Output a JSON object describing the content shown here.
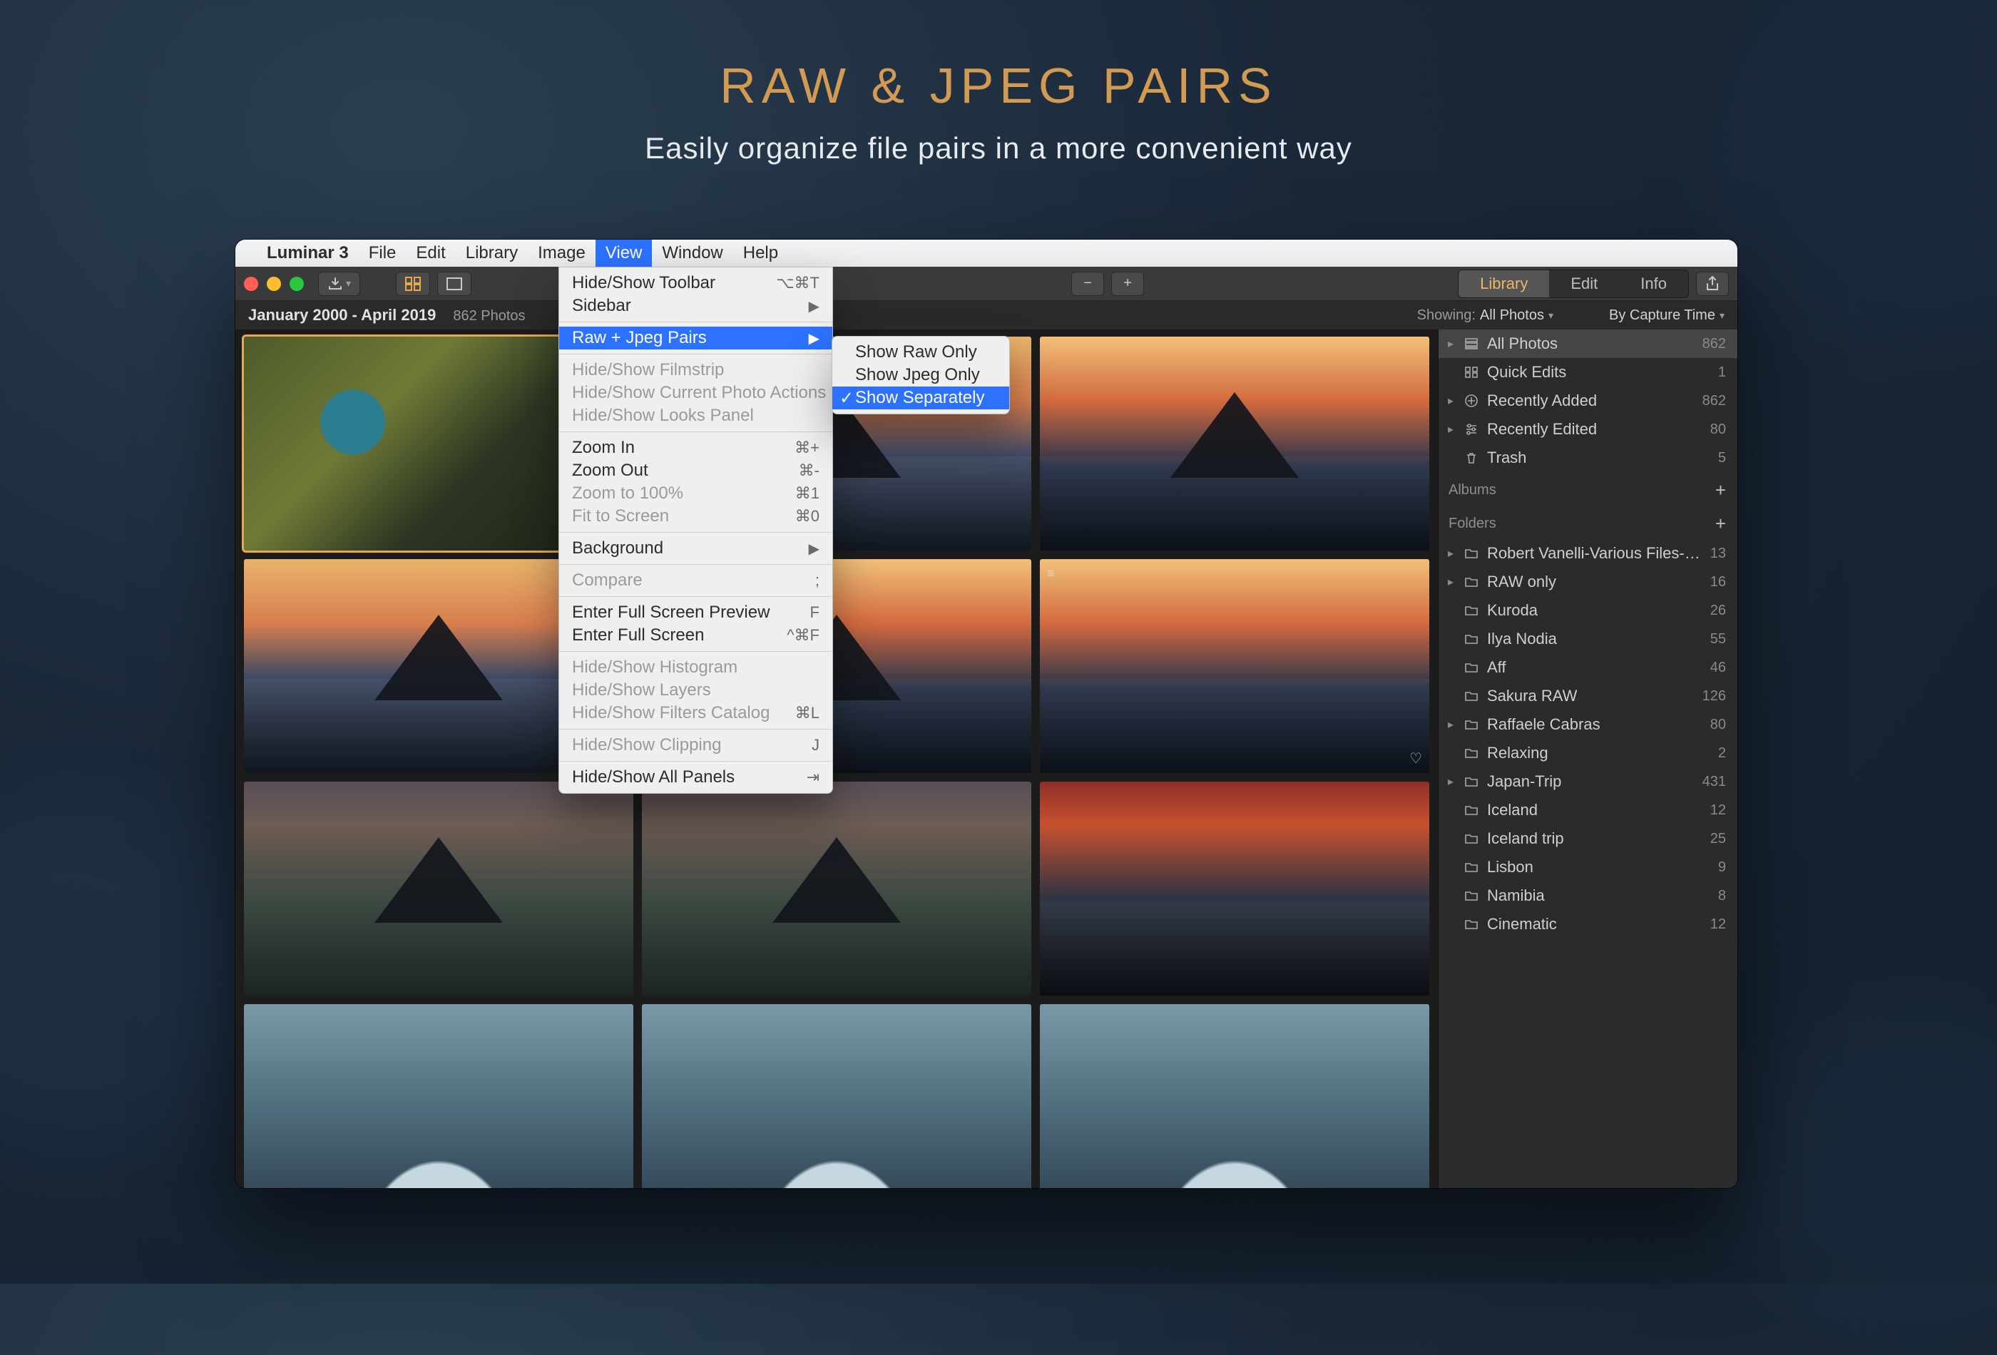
{
  "promo": {
    "headline": "RAW & JPEG PAIRS",
    "subhead": "Easily organize file pairs in a more convenient way"
  },
  "menubar": {
    "app_name": "Luminar 3",
    "items": [
      "File",
      "Edit",
      "Library",
      "Image",
      "View",
      "Window",
      "Help"
    ],
    "active_index": 4
  },
  "toolbar": {
    "segments": {
      "library": "Library",
      "edit": "Edit",
      "info": "Info",
      "active": "library"
    }
  },
  "context": {
    "title": "All Photos",
    "date_range": "January 2000 - April 2019",
    "count_label": "862 Photos",
    "showing_label": "Showing:",
    "showing_value": "All Photos",
    "sort_label": "By Capture Time"
  },
  "view_menu": {
    "items": [
      {
        "label": "Hide/Show Toolbar",
        "shortcut": "⌥⌘T"
      },
      {
        "label": "Sidebar",
        "submenu": true
      },
      {
        "sep": true
      },
      {
        "label": "Raw + Jpeg Pairs",
        "submenu": true,
        "highlight": true
      },
      {
        "sep": true
      },
      {
        "label": "Hide/Show Filmstrip",
        "disabled": true
      },
      {
        "label": "Hide/Show Current Photo Actions",
        "disabled": true
      },
      {
        "label": "Hide/Show Looks Panel",
        "disabled": true
      },
      {
        "sep": true
      },
      {
        "label": "Zoom In",
        "shortcut": "⌘+"
      },
      {
        "label": "Zoom Out",
        "shortcut": "⌘-"
      },
      {
        "label": "Zoom to 100%",
        "shortcut": "⌘1",
        "disabled": true
      },
      {
        "label": "Fit to Screen",
        "shortcut": "⌘0",
        "disabled": true
      },
      {
        "sep": true
      },
      {
        "label": "Background",
        "submenu": true
      },
      {
        "sep": true
      },
      {
        "label": "Compare",
        "shortcut": ";",
        "disabled": true
      },
      {
        "sep": true
      },
      {
        "label": "Enter Full Screen Preview",
        "shortcut": "F"
      },
      {
        "label": "Enter Full Screen",
        "shortcut": "^⌘F"
      },
      {
        "sep": true
      },
      {
        "label": "Hide/Show Histogram",
        "disabled": true
      },
      {
        "label": "Hide/Show Layers",
        "disabled": true
      },
      {
        "label": "Hide/Show Filters Catalog",
        "shortcut": "⌘L",
        "disabled": true
      },
      {
        "sep": true
      },
      {
        "label": "Hide/Show Clipping",
        "shortcut": "J",
        "disabled": true
      },
      {
        "sep": true
      },
      {
        "label": "Hide/Show All Panels",
        "shortcut": "⇥"
      }
    ]
  },
  "submenu": {
    "items": [
      {
        "label": "Show Raw Only"
      },
      {
        "label": "Show Jpeg Only"
      },
      {
        "label": "Show Separately",
        "checked": true,
        "highlight": true
      }
    ]
  },
  "sidebar": {
    "shortcuts": [
      {
        "icon": "stack",
        "label": "All Photos",
        "count": "862",
        "disclosure": true,
        "highlight": true
      },
      {
        "icon": "grid",
        "label": "Quick Edits",
        "count": "1"
      },
      {
        "icon": "plus-circle",
        "label": "Recently Added",
        "count": "862",
        "disclosure": true
      },
      {
        "icon": "sliders",
        "label": "Recently Edited",
        "count": "80",
        "disclosure": true
      },
      {
        "icon": "trash",
        "label": "Trash",
        "count": "5"
      }
    ],
    "albums_label": "Albums",
    "folders_label": "Folders",
    "folders": [
      {
        "label": "Robert Vanelli-Various Files-Out…",
        "count": "13",
        "disclosure": true
      },
      {
        "label": "RAW only",
        "count": "16",
        "disclosure": true
      },
      {
        "label": "Kuroda",
        "count": "26"
      },
      {
        "label": "Ilya Nodia",
        "count": "55"
      },
      {
        "label": "Aff",
        "count": "46"
      },
      {
        "label": "Sakura RAW",
        "count": "126"
      },
      {
        "label": "Raffaele Cabras",
        "count": "80",
        "disclosure": true
      },
      {
        "label": "Relaxing",
        "count": "2"
      },
      {
        "label": "Japan-Trip",
        "count": "431",
        "disclosure": true
      },
      {
        "label": "Iceland",
        "count": "12"
      },
      {
        "label": "Iceland trip",
        "count": "25"
      },
      {
        "label": "Lisbon",
        "count": "9"
      },
      {
        "label": "Namibia",
        "count": "8"
      },
      {
        "label": "Cinematic",
        "count": "12"
      }
    ]
  },
  "thumbs": [
    {
      "style": "aerial",
      "selected": true
    },
    {
      "style": "sky-a mountain reflect"
    },
    {
      "style": "sky-b mountain reflect"
    },
    {
      "style": "sky-a mountain reflect"
    },
    {
      "style": "sky-b mountain reflect",
      "edited": true
    },
    {
      "style": "sky-b reflect",
      "heart": true,
      "edited": true
    },
    {
      "style": "falls mountain"
    },
    {
      "style": "falls mountain"
    },
    {
      "style": "sky-c reflect"
    },
    {
      "style": "ice"
    },
    {
      "style": "ice"
    },
    {
      "style": "ice"
    }
  ]
}
